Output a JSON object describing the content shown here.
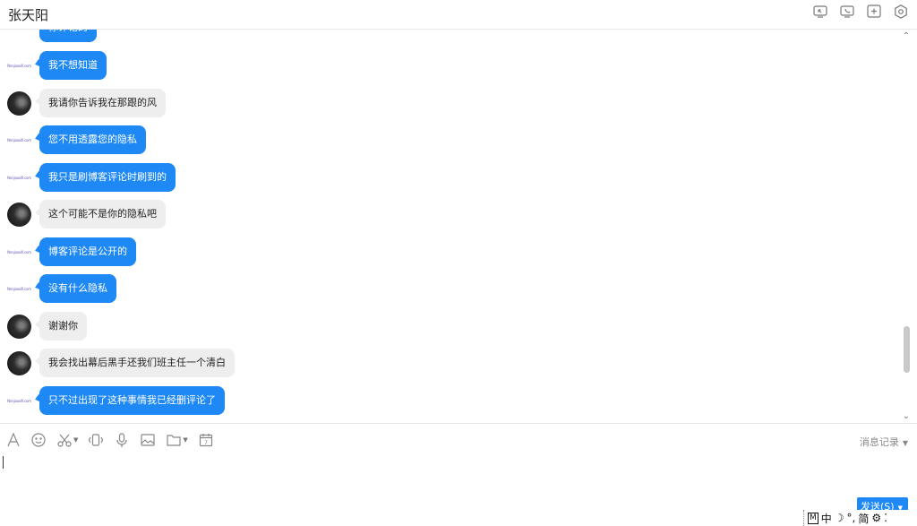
{
  "header": {
    "title": "张天阳",
    "icons": [
      "screen-share-icon",
      "phone-icon",
      "add-member-icon",
      "settings-icon"
    ]
  },
  "partial_top_message": "你评论的",
  "messages": [
    {
      "sender": "self",
      "text": "我不想知道"
    },
    {
      "sender": "other",
      "text": "我请你告诉我在那跟的风"
    },
    {
      "sender": "self",
      "text": "您不用透露您的隐私"
    },
    {
      "sender": "self",
      "text": "我只是刷博客评论时刷到的"
    },
    {
      "sender": "other",
      "text": "这个可能不是你的隐私吧"
    },
    {
      "sender": "self",
      "text": "博客评论是公开的"
    },
    {
      "sender": "self",
      "text": "没有什么隐私"
    },
    {
      "sender": "other",
      "text": "谢谢你"
    },
    {
      "sender": "other",
      "text": "我会找出幕后黑手还我们班主任一个清白"
    },
    {
      "sender": "self",
      "text": "只不过出现了这种事情我已经删评论了"
    }
  ],
  "self_avatar_text": "Nnnjaoxifi.com",
  "toolbar": {
    "icons": [
      "font-icon",
      "emoji-icon",
      "screenshot-scissors-icon",
      "shake-icon",
      "voice-icon",
      "image-icon",
      "folder-icon",
      "calendar-icon"
    ],
    "history_label": "消息记录"
  },
  "input": {
    "value": ""
  },
  "send_button": {
    "label": "发送(S)"
  },
  "ime": {
    "mode_box": "M",
    "lang": "中",
    "moon": "☽",
    "punct": "°,",
    "script": "简",
    "gear": "⚙",
    "more": "⁚"
  }
}
